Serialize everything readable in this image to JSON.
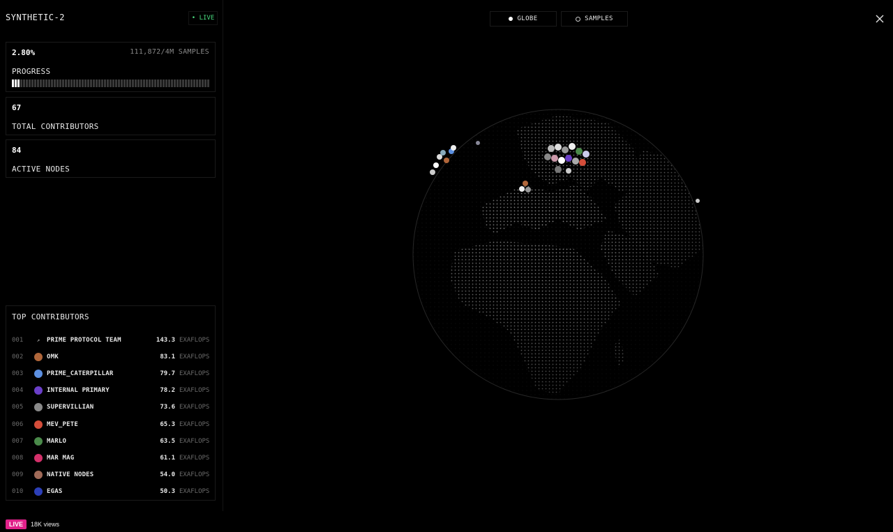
{
  "app": {
    "title": "SYNTHETIC-2",
    "live_label": "• LIVE"
  },
  "progress": {
    "percent_text": "2.80%",
    "samples_text": "111,872/4M SAMPLES",
    "label": "PROGRESS",
    "fraction": 0.028
  },
  "contributors": {
    "value": "67",
    "label": "TOTAL CONTRIBUTORS"
  },
  "nodes": {
    "value": "84",
    "label": "ACTIVE NODES"
  },
  "top": {
    "title": "TOP CONTRIBUTORS",
    "unit": "EXAFLOPS",
    "rows": [
      {
        "rank": "001",
        "name": "PRIME PROTOCOL TEAM",
        "value": "143.3",
        "avatar_icon": "prime-logo-icon",
        "color": "#000000"
      },
      {
        "rank": "002",
        "name": "OMK",
        "value": "83.1",
        "avatar_icon": "avatar-icon",
        "color": "#b0663a"
      },
      {
        "rank": "003",
        "name": "PRIME_CATERPILLAR",
        "value": "79.7",
        "avatar_icon": "avatar-icon",
        "color": "#5c8fe0"
      },
      {
        "rank": "004",
        "name": "INTERNAL PRIMARY",
        "value": "78.2",
        "avatar_icon": "avatar-icon",
        "color": "#6b3fc9"
      },
      {
        "rank": "005",
        "name": "SUPERVILLIAN",
        "value": "73.6",
        "avatar_icon": "avatar-icon",
        "color": "#8a8a8a"
      },
      {
        "rank": "006",
        "name": "MEV_PETE",
        "value": "65.3",
        "avatar_icon": "avatar-icon",
        "color": "#d44d3a"
      },
      {
        "rank": "007",
        "name": "MARLO",
        "value": "63.5",
        "avatar_icon": "avatar-icon",
        "color": "#4a8a4a"
      },
      {
        "rank": "008",
        "name": "MAR MAG",
        "value": "61.1",
        "avatar_icon": "avatar-icon",
        "color": "#d4306a"
      },
      {
        "rank": "009",
        "name": "NATIVE NODES",
        "value": "54.0",
        "avatar_icon": "avatar-icon",
        "color": "#a06a58"
      },
      {
        "rank": "010",
        "name": "EGAS",
        "value": "50.3",
        "avatar_icon": "avatar-icon",
        "color": "#2c3fb8"
      }
    ]
  },
  "view_toggle": {
    "globe_label": "GLOBE",
    "samples_label": "SAMPLES",
    "selected": "globe"
  },
  "stream": {
    "live_label": "LIVE",
    "views": "18K views"
  }
}
